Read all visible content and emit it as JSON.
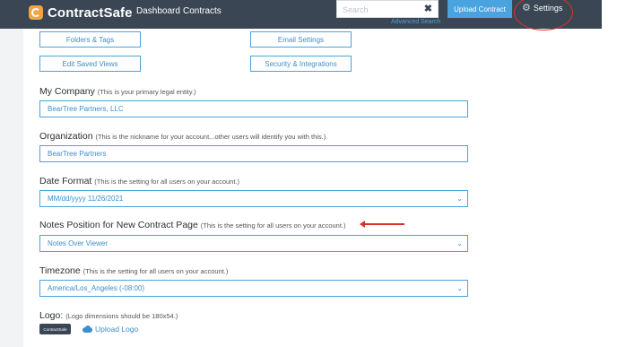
{
  "header": {
    "brand": "ContractSafe",
    "nav": [
      "Dashboard",
      "Contracts"
    ],
    "search_placeholder": "Search",
    "advanced_search": "Advanced Search",
    "upload_label": "Upload Contract",
    "settings_label": "Settings"
  },
  "buttons": {
    "folders_tags": "Folders & Tags",
    "email_settings": "Email Settings",
    "edit_saved_views": "Edit Saved Views",
    "security_integrations": "Security & Integrations"
  },
  "my_company": {
    "label": "My Company",
    "note": "(This is your primary legal entity.)",
    "value": "BearTree Partners, LLC"
  },
  "organization": {
    "label": "Organization",
    "note": "(This is the nickname for your account...other users will identify you with this.)",
    "value": "BearTree Partners"
  },
  "date_format": {
    "label": "Date Format",
    "note": "(This is the setting for all users on your account.)",
    "value": "MM/dd/yyyy 11/26/2021"
  },
  "notes_position": {
    "label": "Notes Position for New Contract Page",
    "note": "(This is the setting for all users on your account.)",
    "value": "Notes Over Viewer"
  },
  "timezone": {
    "label": "Timezone",
    "note": "(This is the setting for all users on your account.)",
    "value": "America/Los_Angeles (-08:00)"
  },
  "logo": {
    "label": "Logo:",
    "note": "(Logo dimensions should be 180x54.)",
    "badge_text": "ContractSafe",
    "upload_label": "Upload Logo"
  },
  "colors": {
    "header_bg": "#3a4654",
    "accent": "#4aa3df",
    "annotation": "#d7322a",
    "brand_orange": "#f0a442"
  }
}
